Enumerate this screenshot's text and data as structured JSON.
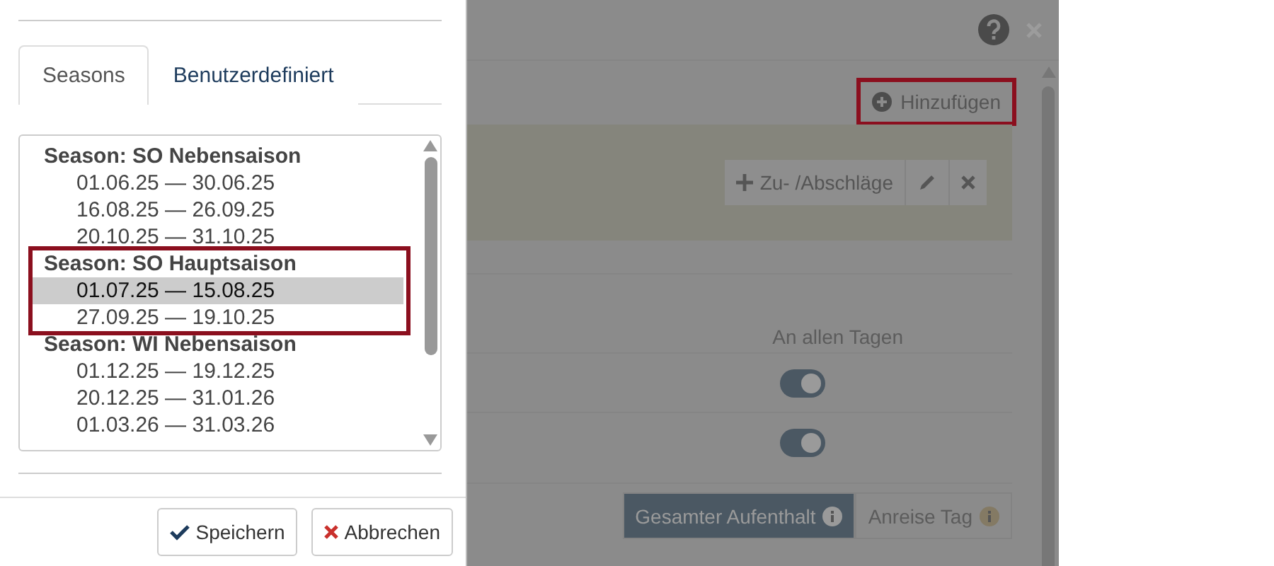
{
  "dialog": {
    "tabs": [
      {
        "label": "Seasons",
        "selected": true
      },
      {
        "label": "Benutzerdefiniert",
        "selected": false
      }
    ],
    "season_groups": [
      {
        "title": "Season: SO Nebensaison",
        "highlighted": false,
        "ranges": [
          {
            "label": "01.06.25 — 30.06.25",
            "selected": false
          },
          {
            "label": "16.08.25 — 26.09.25",
            "selected": false
          },
          {
            "label": "20.10.25 — 31.10.25",
            "selected": false
          }
        ]
      },
      {
        "title": "Season: SO Hauptsaison",
        "highlighted": true,
        "ranges": [
          {
            "label": "01.07.25 — 15.08.25",
            "selected": true
          },
          {
            "label": "27.09.25 — 19.10.25",
            "selected": false
          }
        ]
      },
      {
        "title": "Season: WI Nebensaison",
        "highlighted": false,
        "ranges": [
          {
            "label": "01.12.25 — 19.12.25",
            "selected": false
          },
          {
            "label": "20.12.25 — 31.01.26",
            "selected": false
          },
          {
            "label": "01.03.26 — 31.03.26",
            "selected": false
          }
        ]
      }
    ],
    "buttons": [
      {
        "label": "Speichern",
        "kind": "save"
      },
      {
        "label": "Abbrechen",
        "kind": "cancel"
      }
    ]
  },
  "background": {
    "add_button": {
      "label": "Hinzufügen",
      "highlighted": true
    },
    "surcharge_button": {
      "label": "Zu- /Abschläge"
    },
    "column_header": "An allen Tagen",
    "toggles": [
      {
        "on": true
      },
      {
        "on": true
      }
    ],
    "segments": [
      {
        "label": "Gesamter Aufenthalt",
        "selected": true
      },
      {
        "label": "Anreise Tag",
        "selected": false
      }
    ]
  }
}
